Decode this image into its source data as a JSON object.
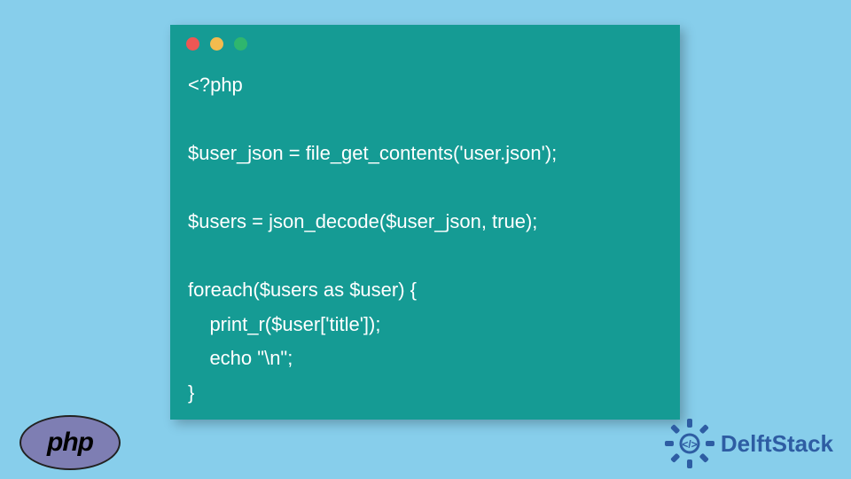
{
  "code_window": {
    "controls": [
      "red",
      "yellow",
      "green"
    ],
    "code": "<?php\n\n$user_json = file_get_contents('user.json');\n\n$users = json_decode($user_json, true);\n\nforeach($users as $user) {\n    print_r($user['title']);\n    echo \"\\n\";\n}"
  },
  "php_logo": {
    "text": "php"
  },
  "delftstack": {
    "text": "DelftStack"
  }
}
